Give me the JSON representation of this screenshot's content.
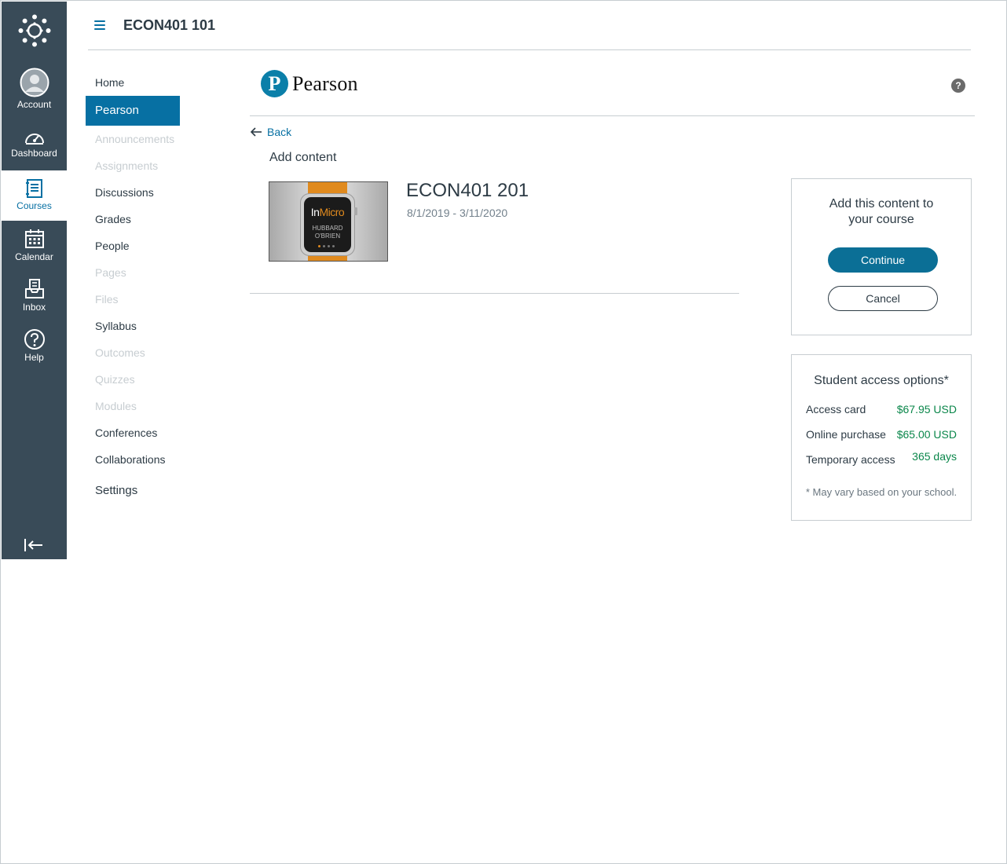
{
  "global_nav": {
    "items": [
      {
        "label": "Account",
        "icon": "avatar-icon"
      },
      {
        "label": "Dashboard",
        "icon": "dashboard-icon"
      },
      {
        "label": "Courses",
        "icon": "courses-icon",
        "active": true
      },
      {
        "label": "Calendar",
        "icon": "calendar-icon"
      },
      {
        "label": "Inbox",
        "icon": "inbox-icon"
      },
      {
        "label": "Help",
        "icon": "help-icon"
      }
    ],
    "colors": {
      "background": "#394b58",
      "active_text": "#0770a3"
    }
  },
  "header": {
    "course_title": "ECON401 101"
  },
  "course_nav": {
    "items": [
      {
        "label": "Home",
        "state": "enabled"
      },
      {
        "label": "Pearson",
        "state": "active"
      },
      {
        "label": "Announcements",
        "state": "disabled"
      },
      {
        "label": "Assignments",
        "state": "disabled"
      },
      {
        "label": "Discussions",
        "state": "enabled"
      },
      {
        "label": "Grades",
        "state": "enabled"
      },
      {
        "label": "People",
        "state": "enabled"
      },
      {
        "label": "Pages",
        "state": "disabled"
      },
      {
        "label": "Files",
        "state": "disabled"
      },
      {
        "label": "Syllabus",
        "state": "enabled"
      },
      {
        "label": "Outcomes",
        "state": "disabled"
      },
      {
        "label": "Quizzes",
        "state": "disabled"
      },
      {
        "label": "Modules",
        "state": "disabled"
      },
      {
        "label": "Conferences",
        "state": "enabled"
      },
      {
        "label": "Collaborations",
        "state": "enabled"
      },
      {
        "label": "Settings",
        "state": "enabled"
      }
    ]
  },
  "pearson": {
    "logo_letter": "P",
    "brand_name": "Pearson",
    "help_glyph": "?"
  },
  "content": {
    "back_label": "Back",
    "heading": "Add content",
    "product": {
      "title": "ECON401 201",
      "dates": "8/1/2019 - 3/11/2020",
      "cover": {
        "brand_in": "In",
        "brand_micro": "Micro",
        "author_line1": "HUBBARD",
        "author_line2": "O'BRIEN"
      }
    }
  },
  "add_panel": {
    "title": "Add this content to your course",
    "continue_label": "Continue",
    "cancel_label": "Cancel"
  },
  "access_panel": {
    "title": "Student access options*",
    "rows": [
      {
        "label": "Access card",
        "value": "$67.95 USD"
      },
      {
        "label": "Online purchase",
        "value": "$65.00 USD"
      },
      {
        "label": "Temporary access",
        "value": "365 days"
      }
    ],
    "footnote": "* May vary based on your school."
  }
}
